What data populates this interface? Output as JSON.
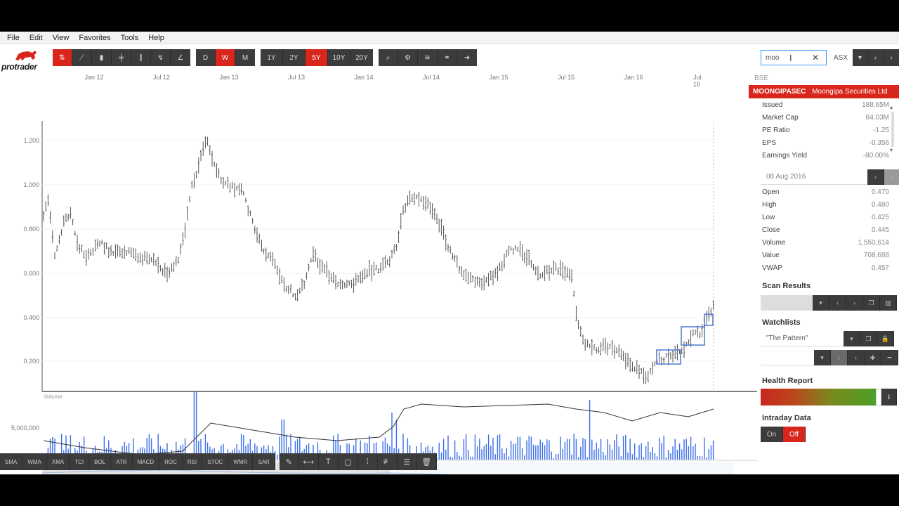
{
  "menu": [
    "File",
    "Edit",
    "View",
    "Favorites",
    "Tools",
    "Help"
  ],
  "logo": {
    "text": "protrader"
  },
  "toolbar": {
    "chart_types": [
      {
        "icon": "line-chart-icon",
        "glyph": "⇅",
        "active": true
      },
      {
        "icon": "trend-icon",
        "glyph": "⟋",
        "active": false
      },
      {
        "icon": "candlestick-icon",
        "glyph": "▮",
        "active": false
      },
      {
        "icon": "ohlc-icon",
        "glyph": "╪",
        "active": false
      },
      {
        "icon": "bars-icon",
        "glyph": "∥",
        "active": false
      },
      {
        "icon": "zigzag-icon",
        "glyph": "↯",
        "active": false
      },
      {
        "icon": "draw-icon",
        "glyph": "∠",
        "active": false
      }
    ],
    "periods": [
      {
        "label": "D",
        "active": false
      },
      {
        "label": "W",
        "active": true
      },
      {
        "label": "M",
        "active": false
      }
    ],
    "ranges": [
      {
        "label": "1Y",
        "active": false
      },
      {
        "label": "2Y",
        "active": false
      },
      {
        "label": "5Y",
        "active": true
      },
      {
        "label": "10Y",
        "active": false
      },
      {
        "label": "20Y",
        "active": false
      }
    ],
    "tools": [
      {
        "icon": "search-icon",
        "glyph": "⌕"
      },
      {
        "icon": "settings-icon",
        "glyph": "⚙"
      },
      {
        "icon": "layers-icon",
        "glyph": "≋"
      },
      {
        "icon": "link-icon",
        "glyph": "⚭"
      },
      {
        "icon": "arrow-right-icon",
        "glyph": "➜"
      }
    ]
  },
  "search": {
    "value": "moo",
    "clear": "✕"
  },
  "exchange": "ASX",
  "dropdown": {
    "heading": "BSE",
    "results": [
      {
        "code": "MOONGIPASEC",
        "name": "Moongipa Securities Ltd"
      }
    ]
  },
  "x_axis": [
    "Jan 12",
    "Jul 12",
    "Jan 13",
    "Jul 13",
    "Jan 14",
    "Jul 14",
    "Jan 15",
    "Jul 15",
    "Jan 16",
    "Jul 16"
  ],
  "y_axis": [
    "1.200",
    "1.000",
    "0.800",
    "0.600",
    "0.400",
    "0.200"
  ],
  "volume": {
    "label": "Volume",
    "tick": "5,000,000"
  },
  "stock_info": [
    {
      "label": "Issued",
      "value": "188.65M"
    },
    {
      "label": "Market Cap",
      "value": "84.03M"
    },
    {
      "label": "PE Ratio",
      "value": "-1.25"
    },
    {
      "label": "EPS",
      "value": "-0.356"
    },
    {
      "label": "Earnings Yield",
      "value": "-80.00%"
    }
  ],
  "date": "08 Aug 2016",
  "price_data": [
    {
      "label": "Open",
      "value": "0.470"
    },
    {
      "label": "High",
      "value": "0.480"
    },
    {
      "label": "Low",
      "value": "0.425"
    },
    {
      "label": "Close",
      "value": "0.445"
    },
    {
      "label": "Volume",
      "value": "1,550,614"
    },
    {
      "label": "Value",
      "value": "708,688"
    },
    {
      "label": "VWAP",
      "value": "0.457"
    }
  ],
  "sections": {
    "scan_results": "Scan Results",
    "watchlists": "Watchlists",
    "watchlist_name": "\"The Pattern\"",
    "health_report": "Health Report",
    "intraday": "Intraday Data",
    "on": "On",
    "off": "Off"
  },
  "indicators": [
    "SMA",
    "WMA",
    "XMA",
    "TCI",
    "BOL",
    "ATR",
    "MACD",
    "ROC",
    "RSI",
    "STOC",
    "WMR",
    "SAR"
  ],
  "draw_tools": [
    {
      "icon": "pen-icon",
      "glyph": "✎"
    },
    {
      "icon": "horizontal-line-icon",
      "glyph": "⟷"
    },
    {
      "icon": "text-icon",
      "glyph": "T"
    },
    {
      "icon": "rectangle-icon",
      "glyph": "▢"
    },
    {
      "icon": "channel-icon",
      "glyph": "⁞"
    },
    {
      "icon": "fibonacci-icon",
      "glyph": "≢"
    },
    {
      "icon": "menu-icon",
      "glyph": "☰"
    },
    {
      "icon": "trash-icon",
      "glyph": "🗑"
    }
  ],
  "colors": {
    "accent": "#d9261c",
    "toolbar": "#3c3c3c",
    "volume": "#3a6ee8",
    "box": "#4a78d0"
  }
}
